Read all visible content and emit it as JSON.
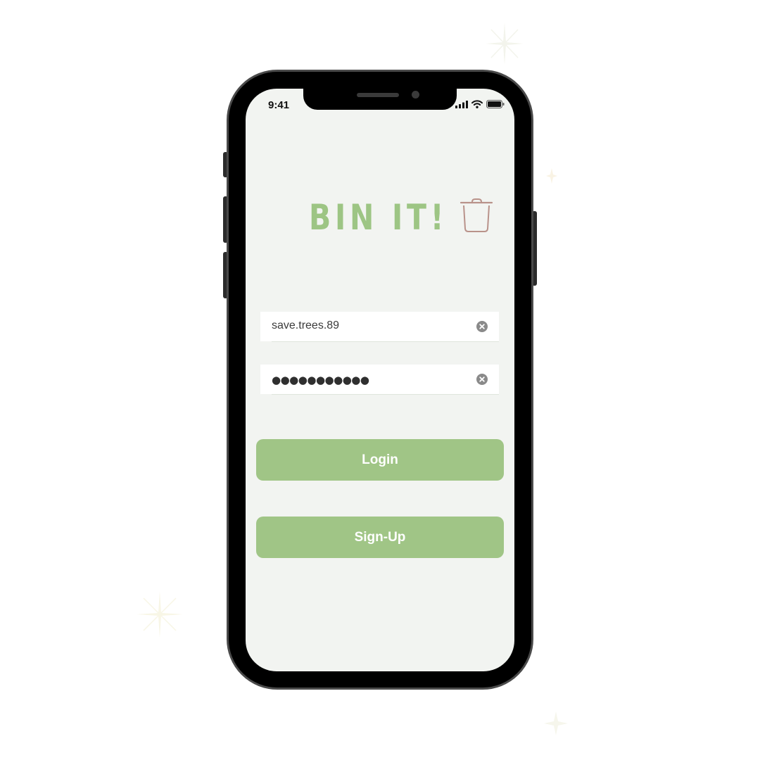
{
  "status_bar": {
    "time": "9:41"
  },
  "app": {
    "logo_text": "BIN IT!",
    "brand_color": "#9dc584",
    "bin_icon": "trash-bin-icon"
  },
  "login_form": {
    "username": {
      "value": "save.trees.89"
    },
    "password": {
      "masked_value": "●●●●●●●●●●●"
    },
    "login_label": "Login",
    "signup_label": "Sign-Up",
    "button_color": "#a0c586"
  }
}
